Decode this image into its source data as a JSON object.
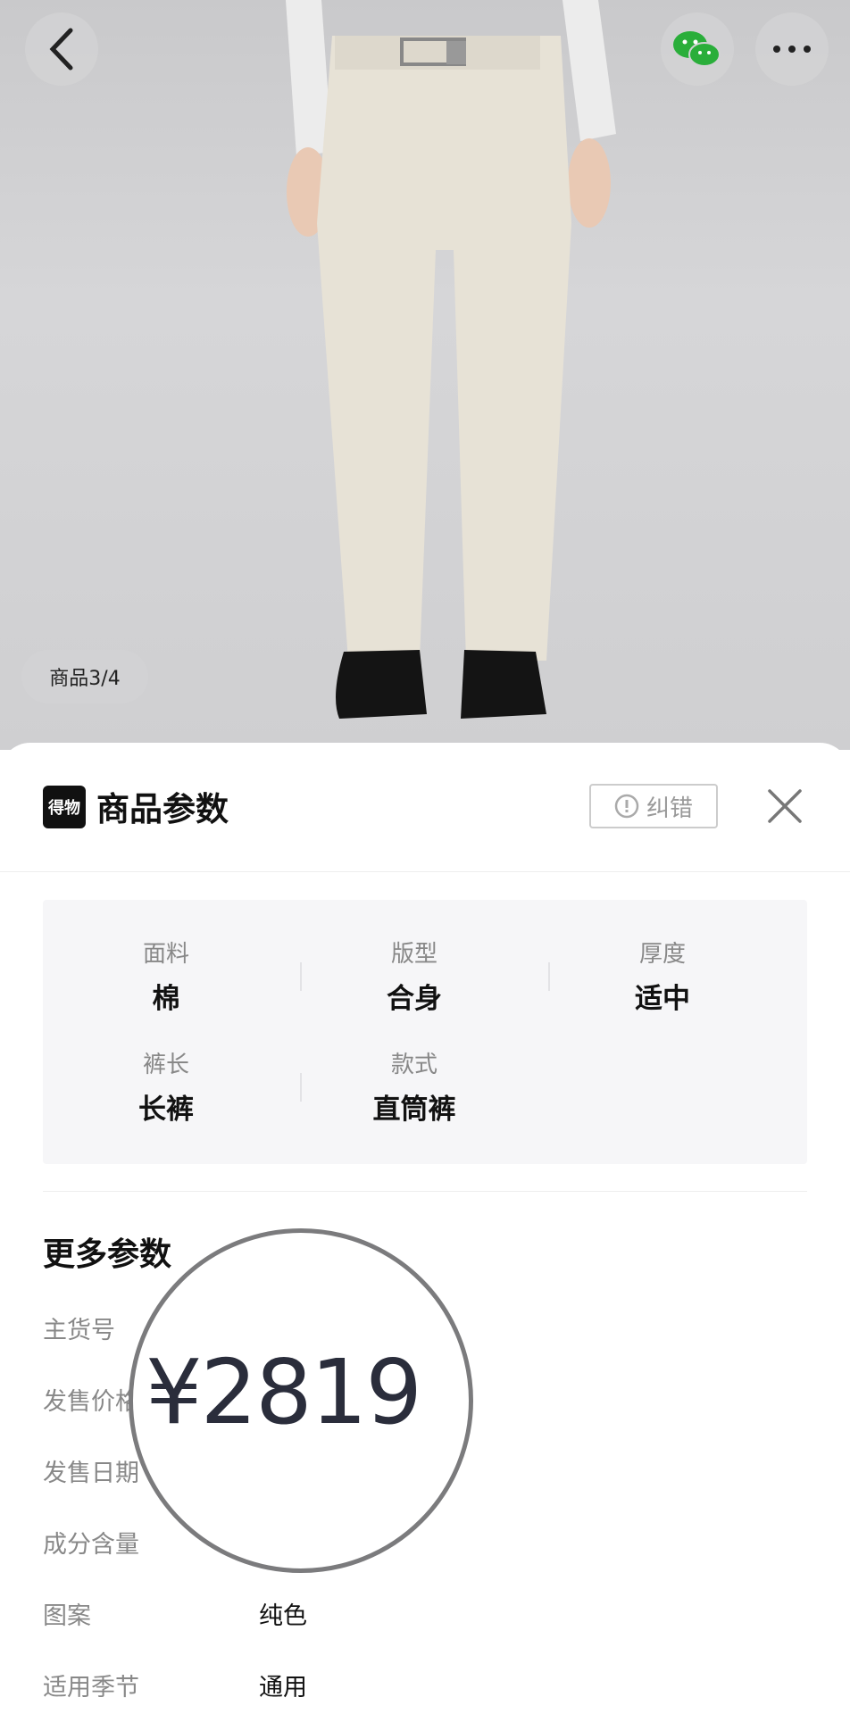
{
  "photo": {
    "counter": "商品3/4"
  },
  "icons": {
    "back": "chevron-left-icon",
    "wechat": "wechat-icon",
    "more": "more-dots-icon",
    "close": "close-icon",
    "info": "info-circle-icon"
  },
  "sheet": {
    "brand_logo_text": "得物",
    "title": "商品参数",
    "correction_label": "纠错",
    "params": [
      {
        "label": "面料",
        "value": "棉"
      },
      {
        "label": "版型",
        "value": "合身"
      },
      {
        "label": "厚度",
        "value": "适中"
      },
      {
        "label": "裤长",
        "value": "长裤"
      },
      {
        "label": "款式",
        "value": "直筒裤"
      }
    ],
    "more_title": "更多参数",
    "more_rows": [
      {
        "key": "主货号",
        "value": ""
      },
      {
        "key": "发售价格",
        "value": ""
      },
      {
        "key": "发售日期",
        "value": ""
      },
      {
        "key": "成分含量",
        "value": ""
      },
      {
        "key": "图案",
        "value": "纯色"
      },
      {
        "key": "适用季节",
        "value": "通用"
      }
    ],
    "magnifier_value": "¥2819"
  },
  "colors": {
    "green": "#2aae3a",
    "text": "#111111",
    "muted": "#888888"
  }
}
